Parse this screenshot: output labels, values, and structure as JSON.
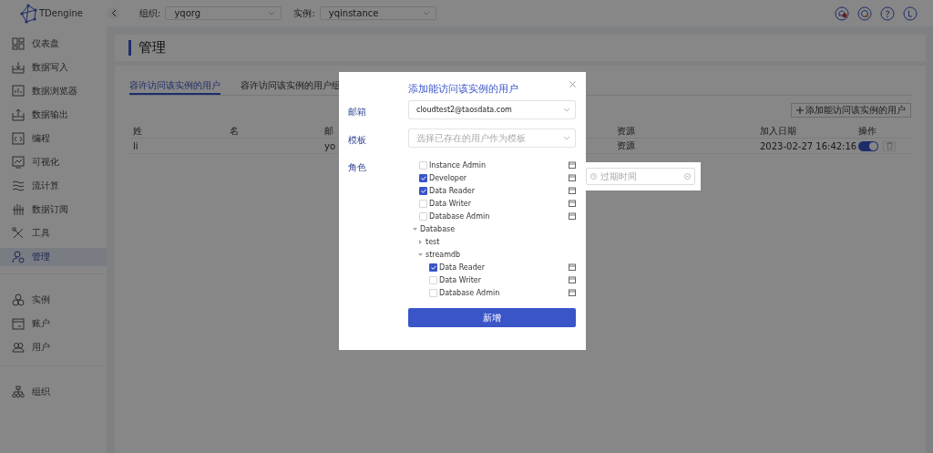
{
  "top_bar": {
    "logo": "TDengine",
    "org_label": "组织:",
    "org": "yqorg",
    "instance_label": "实例:",
    "instance": "yqinstance"
  },
  "sidebar": {
    "groups": [
      [
        {
          "label": "仪表盘",
          "selected": false
        },
        {
          "label": "数据写入",
          "selected": false
        },
        {
          "label": "数据浏览器",
          "selected": false
        },
        {
          "label": "数据输出",
          "selected": false
        },
        {
          "label": "编程",
          "selected": false
        },
        {
          "label": "可视化",
          "selected": false
        },
        {
          "label": "流计算",
          "selected": false
        },
        {
          "label": "数据订阅",
          "selected": false
        },
        {
          "label": "工具",
          "selected": false
        },
        {
          "label": "管理",
          "selected": true
        }
      ],
      [
        {
          "label": "实例",
          "selected": false
        },
        {
          "label": "账户",
          "selected": false
        },
        {
          "label": "用户",
          "selected": false
        }
      ],
      [
        {
          "label": "组织",
          "selected": false
        }
      ]
    ]
  },
  "page_title": "管理",
  "tabs": [
    {
      "label": "容许访问该实例的用户",
      "selected": true
    },
    {
      "label": "容许访问该实例的用户组",
      "selected": false
    }
  ],
  "add_button": "添加能访问该实例的用户",
  "table": {
    "columns": [
      "姓",
      "名",
      "邮",
      "资源",
      "加入日期",
      "操作"
    ],
    "rows": [
      {
        "column_1": "li",
        "column_3": "yo",
        "resource": "资源",
        "joined": "2023-02-27 16:42:16",
        "enabled": true
      }
    ]
  },
  "dialog": {
    "title": "添加能访问该实例的用户",
    "fields": [
      {
        "label": "邮箱",
        "value": "cloudtest2@taosdata.com"
      },
      {
        "label": "模板",
        "placeholder": "选择已存在的用户作为模板"
      }
    ],
    "role_label": "角色",
    "roles": [
      {
        "kind": "role",
        "label": "Instance Admin",
        "checked": false
      },
      {
        "kind": "role",
        "label": "Developer",
        "checked": true
      },
      {
        "kind": "role",
        "label": "Data Reader",
        "checked": true
      },
      {
        "kind": "role",
        "label": "Data Writer",
        "checked": false
      },
      {
        "kind": "role",
        "label": "Database Admin",
        "checked": false
      },
      {
        "kind": "group",
        "label": "Database",
        "expanded": true,
        "children": [
          {
            "kind": "group",
            "label": "test",
            "expanded": false
          },
          {
            "kind": "group",
            "label": "streamdb",
            "expanded": true,
            "children": [
              {
                "kind": "role",
                "label": "Data Reader",
                "checked": true
              },
              {
                "kind": "role",
                "label": "Data Writer",
                "checked": false
              },
              {
                "kind": "role",
                "label": "Database Admin",
                "checked": false
              }
            ]
          }
        ]
      }
    ],
    "submit": "新增"
  },
  "expiry_popover": {
    "placeholder": "过期时间"
  }
}
